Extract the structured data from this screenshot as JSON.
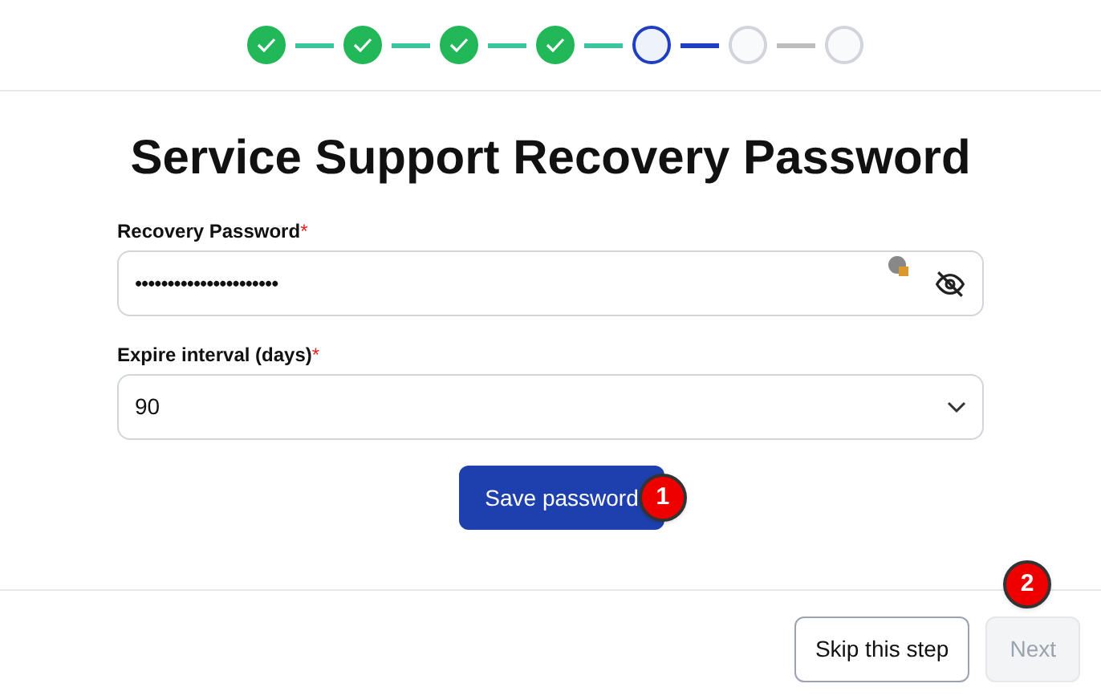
{
  "stepper": {
    "steps": [
      {
        "done": true,
        "selected": false
      },
      {
        "done": true,
        "selected": false
      },
      {
        "done": true,
        "selected": false
      },
      {
        "done": true,
        "selected": false
      },
      {
        "done": false,
        "selected": true
      },
      {
        "done": false,
        "selected": false
      },
      {
        "done": false,
        "selected": false
      }
    ]
  },
  "title": "Service Support Recovery Password",
  "fields": [
    {
      "kind": "password",
      "label": "Recovery Password",
      "required_mark": "*",
      "value": "••••••••••••••••••••••"
    },
    {
      "kind": "select",
      "label": "Expire interval (days)",
      "required_mark": "*",
      "value": "90"
    }
  ],
  "save_button": {
    "label": "Save password",
    "badge": "1"
  },
  "footer": {
    "skip_button": {
      "label": "Skip this step"
    },
    "next_button": {
      "label": "Next",
      "disabled": true,
      "badge": "2"
    }
  }
}
